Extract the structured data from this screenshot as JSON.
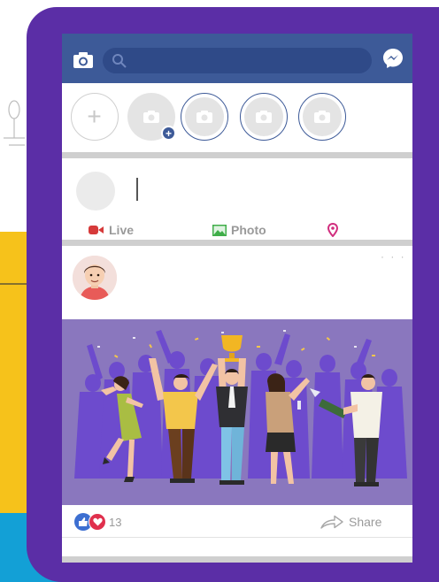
{
  "colors": {
    "frame": "#5b2ea6",
    "topbar": "#3d5a98",
    "search_bg": "#2f4a88",
    "accent_yellow": "#f6c21b",
    "accent_blue": "#13a0d6",
    "image_bg": "#8a77be",
    "live_icon": "#d63a3a",
    "photo_icon": "#3fae49",
    "checkin_icon": "#d12e7e",
    "like": "#3d6fd1",
    "love": "#e0304d"
  },
  "icons": {
    "camera": "camera-icon",
    "search": "search-icon",
    "messenger": "messenger-icon",
    "add_story": "plus-icon",
    "live": "video-camera-icon",
    "photo": "image-icon",
    "check_in": "location-pin-icon",
    "like": "thumbs-up-icon",
    "love": "heart-icon",
    "share": "share-arrow-icon",
    "menu": "more-icon"
  },
  "composer": {
    "actions": [
      {
        "label": "Live"
      },
      {
        "label": "Photo"
      },
      {
        "label": ""
      }
    ]
  },
  "post": {
    "reaction_count": "13",
    "share_label": "Share",
    "menu_label": "· · ·"
  }
}
